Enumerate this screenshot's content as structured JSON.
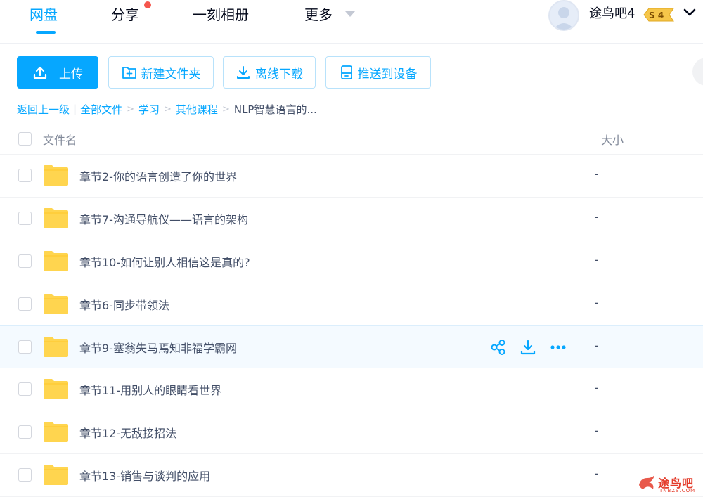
{
  "nav": {
    "tabs": [
      {
        "label": "网盘",
        "active": true
      },
      {
        "label": "分享",
        "active": false,
        "has_notification": true
      },
      {
        "label": "一刻相册",
        "active": false
      },
      {
        "label": "更多",
        "active": false
      }
    ],
    "username": "途鸟吧4",
    "vip_badge": "S 4"
  },
  "toolbar": {
    "upload_label": "上传",
    "new_folder_label": "新建文件夹",
    "offline_download_label": "离线下载",
    "push_device_label": "推送到设备"
  },
  "breadcrumb": {
    "back_label": "返回上一级",
    "items": [
      "全部文件",
      "学习",
      "其他课程"
    ],
    "current": "NLP智慧语言的..."
  },
  "table": {
    "col_name": "文件名",
    "col_size": "大小",
    "rows": [
      {
        "name": "章节2-你的语言创造了你的世界",
        "size": "-"
      },
      {
        "name": "章节7-沟通导航仪——语言的架构",
        "size": "-"
      },
      {
        "name": "章节10-如何让别人相信这是真的?",
        "size": "-"
      },
      {
        "name": "章节6-同步带领法",
        "size": "-"
      },
      {
        "name": "章节9-塞翁失马焉知非福学霸网",
        "size": "-",
        "hovered": true
      },
      {
        "name": "章节11-用别人的眼睛看世界",
        "size": "-"
      },
      {
        "name": "章节12-无敌接招法",
        "size": "-"
      },
      {
        "name": "章节13-销售与谈判的应用",
        "size": "-"
      }
    ]
  },
  "watermark": {
    "text": "途鸟吧",
    "sub": "TNBZS.COM"
  },
  "colors": {
    "accent": "#06a7ff",
    "text": "#424e67",
    "folder": "#ffd54f",
    "notification": "#f5564d"
  }
}
